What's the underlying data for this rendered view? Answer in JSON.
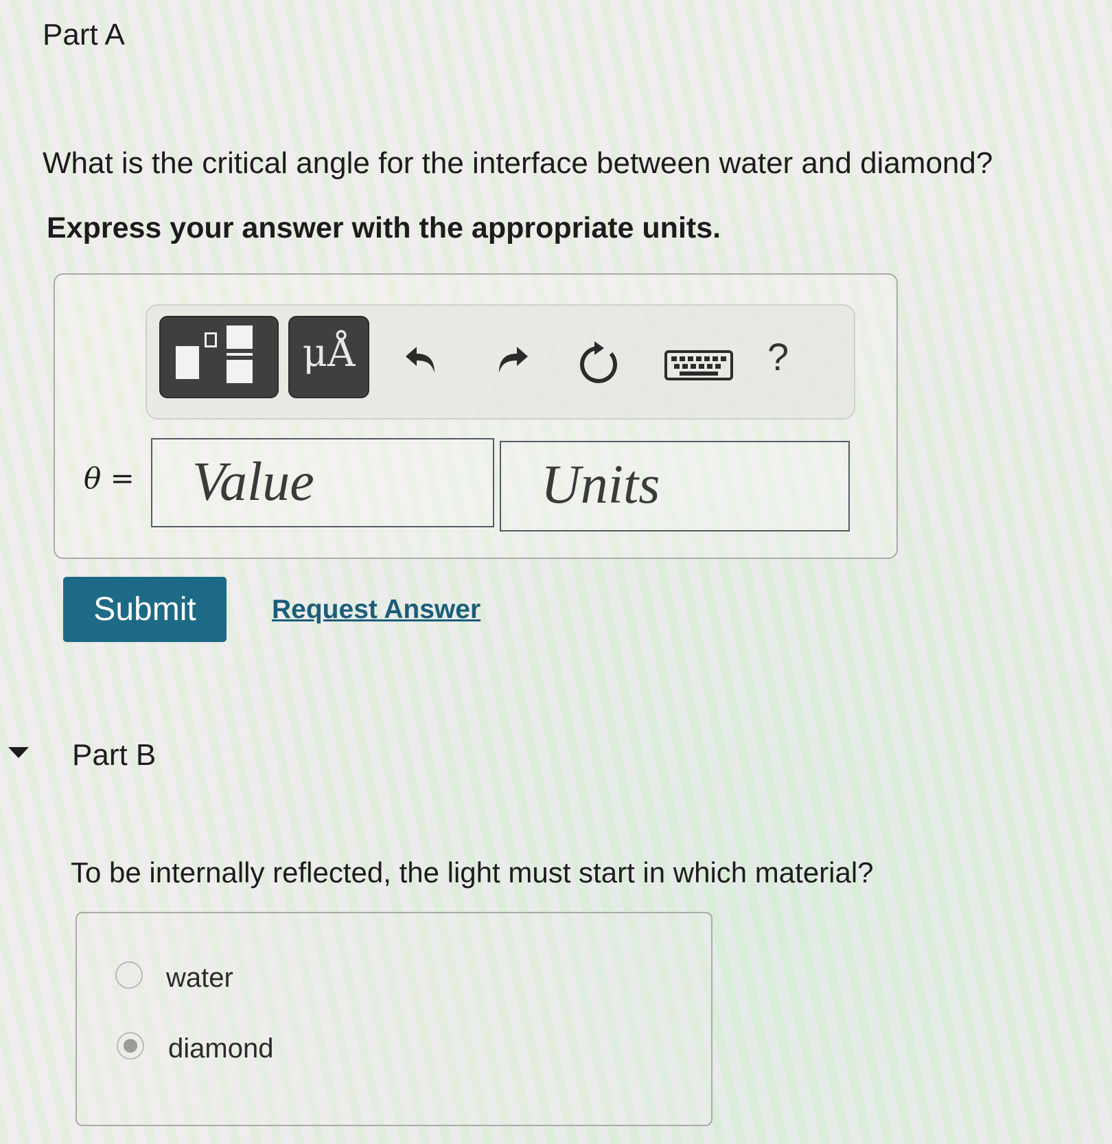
{
  "part_a": {
    "title": "Part A",
    "question": "What is the critical angle for the interface between water and diamond?",
    "instruction": "Express your answer with the appropriate units.",
    "toolbar": {
      "units_label": "μÅ",
      "help_label": "?"
    },
    "variable_label": "θ =",
    "value_placeholder": "Value",
    "units_placeholder": "Units",
    "submit_label": "Submit",
    "request_answer_label": "Request Answer"
  },
  "part_b": {
    "title": "Part B",
    "question": "To be internally reflected, the light must start in which material?",
    "options": [
      {
        "label": "water",
        "selected": false
      },
      {
        "label": "diamond",
        "selected": true
      }
    ]
  },
  "colors": {
    "submit_bg": "#1d6a86",
    "link": "#1b5d7a",
    "toolbar_dark": "#3f3f3f"
  }
}
